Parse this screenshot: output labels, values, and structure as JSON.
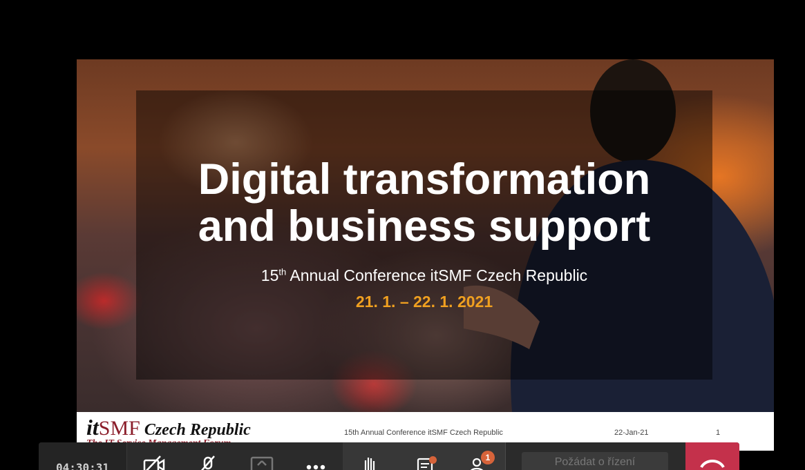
{
  "slide": {
    "title_line1": "Digital transformation",
    "title_line2": "and business support",
    "subtitle_num": "15",
    "subtitle_sup": "th",
    "subtitle_rest": " Annual Conference itSMF Czech Republic",
    "dates": "21. 1. – 22. 1. 2021",
    "footer": {
      "logo_it": "it",
      "logo_smf": "SMF",
      "logo_country": " Czech Republic",
      "logo_tagline": "The IT Service Management Forum",
      "conference": "15th Annual Conference itSMF Czech Republic",
      "date": "22-Jan-21",
      "page": "1"
    }
  },
  "toolbar": {
    "timer": "04:30:31",
    "buttons": [
      {
        "icon": "camera-off-icon"
      },
      {
        "icon": "mic-off-icon"
      },
      {
        "icon": "share-screen-icon"
      },
      {
        "icon": "more-options-icon"
      },
      {
        "icon": "raise-hand-icon"
      },
      {
        "icon": "chat-icon"
      },
      {
        "icon": "participants-icon"
      }
    ],
    "participants_badge": "1",
    "request_control_label": "Požádat o řízení",
    "hangup_icon": "hang-up-icon"
  },
  "colors": {
    "dates": "#f0a020",
    "accent_red": "#c4314b",
    "badge": "#d6633a"
  }
}
